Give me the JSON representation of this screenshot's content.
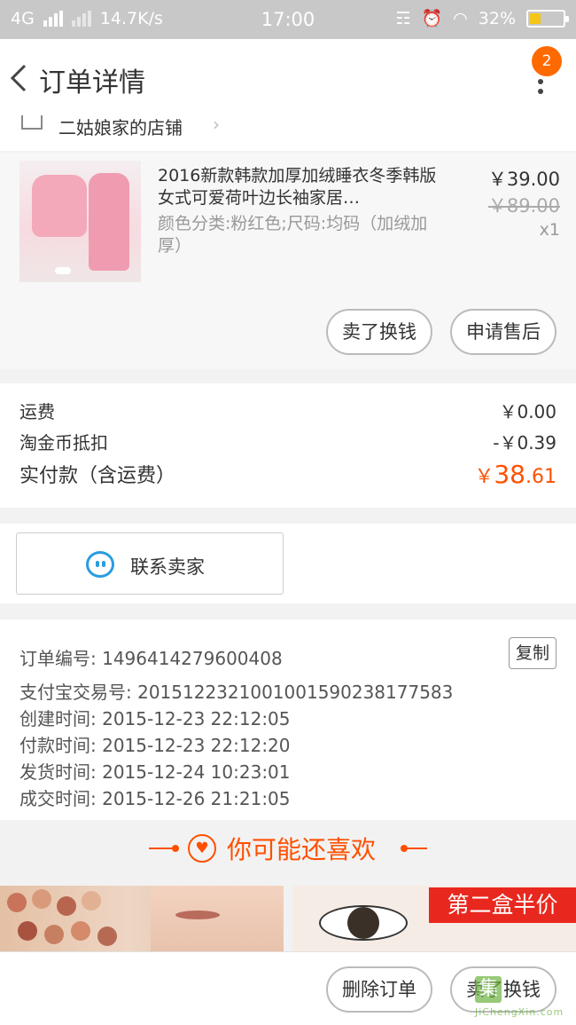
{
  "status_bar": {
    "network": "4G",
    "speed": "14.7K/s",
    "time": "17:00",
    "battery": "32%",
    "battery_level": 0.32,
    "battery_color": "#f5c518"
  },
  "nav": {
    "title": "订单详情",
    "back_icon": "chevron-left-icon",
    "menu_icon": "more-vertical-icon",
    "badge_count": "2",
    "badge_color": "#ff6a00"
  },
  "shop": {
    "name": "二姑娘家的店铺",
    "icon": "shop-icon"
  },
  "item": {
    "title": "2016新款韩款加厚加绒睡衣冬季韩版女式可爱荷叶边长袖家居…",
    "sku": "颜色分类:粉红色;尺码:均码（加绒加厚）",
    "price": "￥39.00",
    "original_price": "￥89.00",
    "quantity": "x1",
    "actions": [
      "卖了换钱",
      "申请售后"
    ]
  },
  "fees": {
    "shipping_label": "运费",
    "shipping_value": "￥0.00",
    "coin_label": "淘金币抵扣",
    "coin_value": "-￥0.39",
    "total_label": "实付款（含运费）",
    "total_currency": "￥",
    "total_int": "38",
    "total_dec": ".61",
    "accent_color": "#ff5000"
  },
  "contact": {
    "label": "联系卖家",
    "icon": "chat-smile-icon"
  },
  "order_info": {
    "order_no": "订单编号: 1496414279600408",
    "copy_label": "复制",
    "alipay_no": "支付宝交易号: 2015122321001001590238177583",
    "created": "创建时间: 2015-12-23 22:12:05",
    "paid": "付款时间: 2015-12-23 22:12:20",
    "shipped": "发货时间: 2015-12-24 10:23:01",
    "completed": "成交时间: 2015-12-26 21:21:05"
  },
  "recommend": {
    "title": "你可能还喜欢",
    "icon": "heart-icon",
    "promo_banner": "第二盒半价"
  },
  "bottom_actions": [
    "删除订单",
    "卖了换钱"
  ],
  "watermark": {
    "logo_char": "集",
    "site": "JiChengXin.com"
  }
}
